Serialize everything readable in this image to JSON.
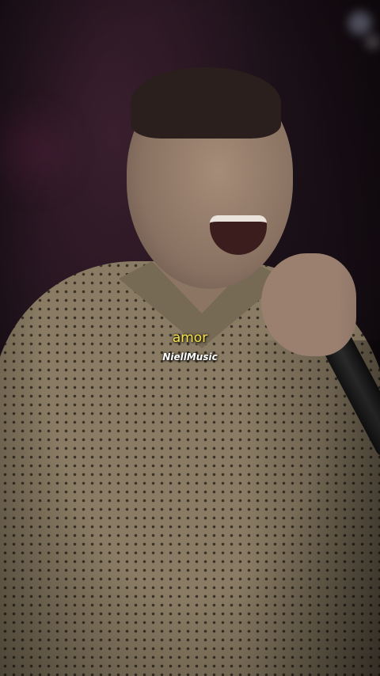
{
  "video": {
    "lyric": "amor",
    "watermark": "NiellMusic",
    "lyric_color": "#f3e04a",
    "watermark_color": "#ffffff"
  }
}
